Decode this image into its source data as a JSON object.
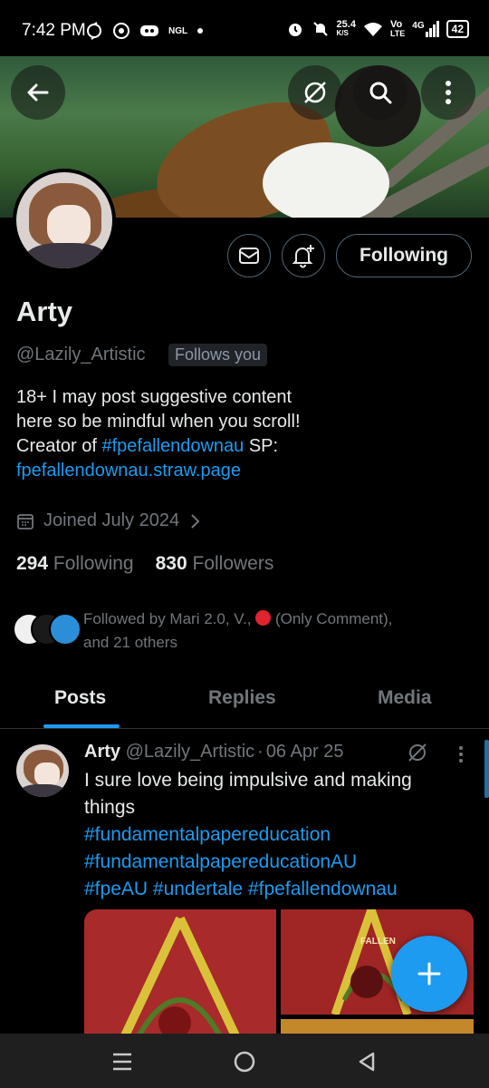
{
  "status_bar": {
    "time": "7:42 PM",
    "left_icons": [
      "sync-icon",
      "whatsapp-icon",
      "discord-icon",
      "ngl-icon",
      "dot-icon"
    ],
    "ngl_label": "NGL",
    "speed_value": "25.4",
    "speed_unit": "K/S",
    "network_top": "Vo",
    "network_bottom": "LTE",
    "network_gen": "4G",
    "battery": "42"
  },
  "profile": {
    "name": "Arty",
    "handle": "@Lazily_Artistic",
    "follows_you": "Follows you",
    "bio_line1": "18+ I may post suggestive content",
    "bio_line2": "here so be mindful when you scroll!",
    "bio_line3_prefix": "Creator of ",
    "bio_hashtag": "#fpefallendownau",
    "bio_line3_suffix": " SP:",
    "bio_link": "fpefallendownau.straw.page",
    "joined": "Joined July 2024",
    "following_count": "294",
    "following_label": "Following",
    "followers_count": "830",
    "followers_label": "Followers",
    "followed_by_prefix": "Followed by Mari 2.0, V., ",
    "followed_by_suffix": " (Only Comment),",
    "followed_by_line2": "and 21 others",
    "follow_button_label": "Following"
  },
  "tabs": [
    {
      "label": "Posts",
      "active": true
    },
    {
      "label": "Replies",
      "active": false
    },
    {
      "label": "Media",
      "active": false
    }
  ],
  "post": {
    "author": "Arty",
    "handle": "@Lazily_Artistic",
    "separator": "·",
    "date": "06 Apr 25",
    "text_line1": "I sure love being impulsive and making",
    "text_line2": "things",
    "hashtag1": "#fundamentalpapereducation",
    "hashtag2": "#fundamentalpapereducationAU",
    "hashtag3": "#fpeAU",
    "hashtag4": "#undertale",
    "hashtag5": "#fpefallendownau",
    "media_caption": "FALLEN"
  },
  "colors": {
    "accent": "#1d9bf0",
    "background": "#000000",
    "secondary_text": "#71767b",
    "primary_text": "#e7e9ea"
  }
}
